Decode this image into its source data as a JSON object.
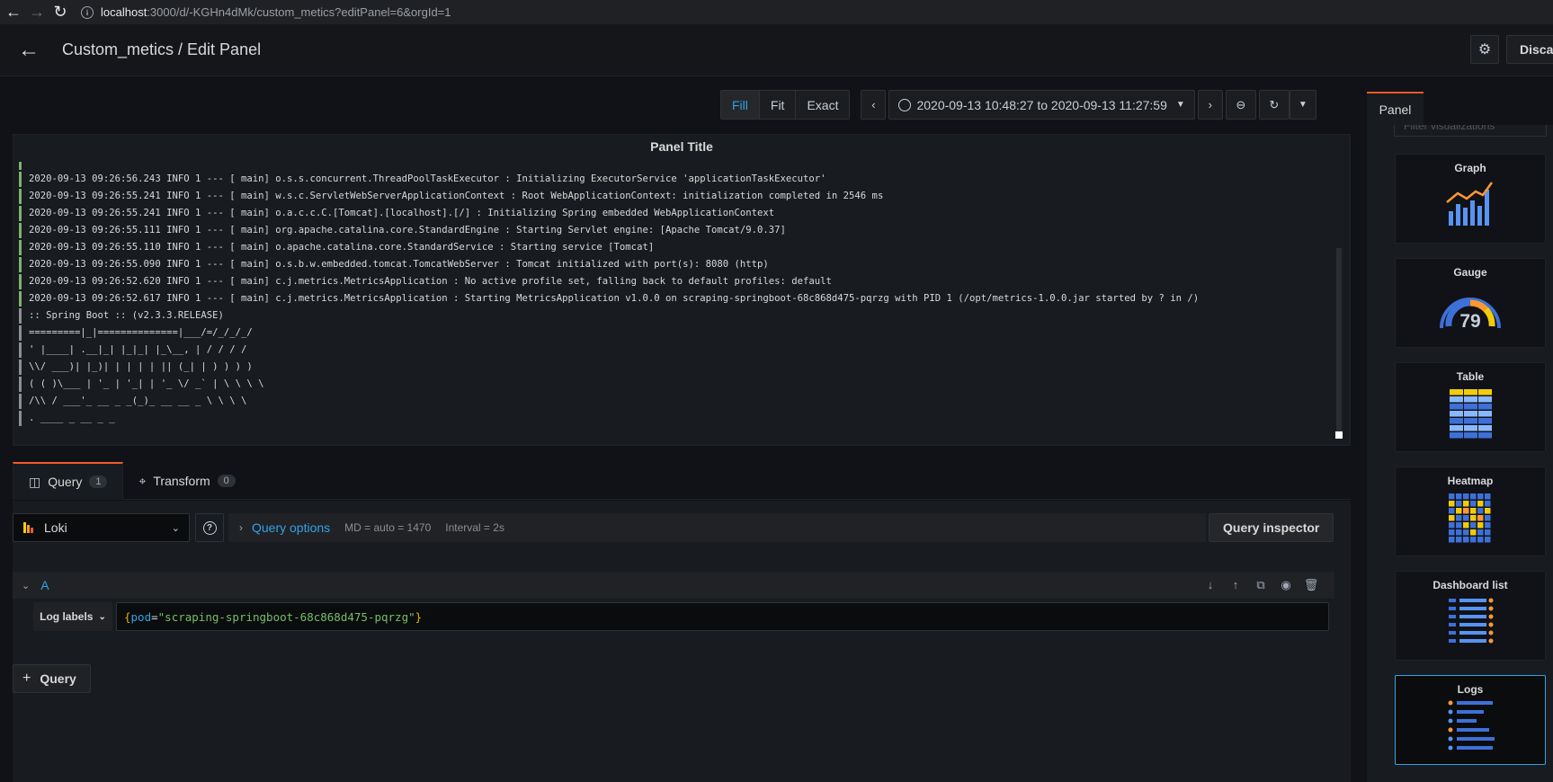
{
  "browser": {
    "url_host": "localhost",
    "url_path": ":3000/d/-KGHn4dMk/custom_metics?editPanel=6&orgId=1"
  },
  "header": {
    "title": "Custom_metics / Edit Panel",
    "discard_label": "Discard"
  },
  "toolbar": {
    "fit_modes": [
      "Fill",
      "Fit",
      "Exact"
    ],
    "active_mode": "Fill",
    "time_range": "2020-09-13 10:48:27 to 2020-09-13 11:27:59"
  },
  "panel": {
    "title": "Panel Title",
    "log_lines": [
      {
        "text": "2020-09-13 09:26:56.243 INFO 1 --- [ main] o.s.s.concurrent.ThreadPoolTaskExecutor : Initializing ExecutorService 'applicationTaskExecutor'",
        "level": "info"
      },
      {
        "text": "2020-09-13 09:26:55.241 INFO 1 --- [ main] w.s.c.ServletWebServerApplicationContext : Root WebApplicationContext: initialization completed in 2546 ms",
        "level": "info"
      },
      {
        "text": "2020-09-13 09:26:55.241 INFO 1 --- [ main] o.a.c.c.C.[Tomcat].[localhost].[/] : Initializing Spring embedded WebApplicationContext",
        "level": "info"
      },
      {
        "text": "2020-09-13 09:26:55.111 INFO 1 --- [ main] org.apache.catalina.core.StandardEngine : Starting Servlet engine: [Apache Tomcat/9.0.37]",
        "level": "info"
      },
      {
        "text": "2020-09-13 09:26:55.110 INFO 1 --- [ main] o.apache.catalina.core.StandardService : Starting service [Tomcat]",
        "level": "info"
      },
      {
        "text": "2020-09-13 09:26:55.090 INFO 1 --- [ main] o.s.b.w.embedded.tomcat.TomcatWebServer : Tomcat initialized with port(s): 8080 (http)",
        "level": "info"
      },
      {
        "text": "2020-09-13 09:26:52.620 INFO 1 --- [ main] c.j.metrics.MetricsApplication : No active profile set, falling back to default profiles: default",
        "level": "info"
      },
      {
        "text": "2020-09-13 09:26:52.617 INFO 1 --- [ main] c.j.metrics.MetricsApplication : Starting MetricsApplication v1.0.0 on scraping-springboot-68c868d475-pqrzg with PID 1 (/opt/metrics-1.0.0.jar started by ? in /)",
        "level": "info"
      },
      {
        "text": ":: Spring Boot :: (v2.3.3.RELEASE)",
        "level": "unknown"
      },
      {
        "text": "=========|_|==============|___/=/_/_/_/",
        "level": "unknown"
      },
      {
        "text": "' |____| .__|_| |_|_| |_\\__, | / / / /",
        "level": "unknown"
      },
      {
        "text": "\\\\/ ___)| |_)| | | | | || (_| | ) ) ) )",
        "level": "unknown"
      },
      {
        "text": "( ( )\\___ | '_ | '_| | '_ \\/ _` | \\ \\ \\ \\",
        "level": "unknown"
      },
      {
        "text": "/\\\\ / ___'_ __ _ _(_)_ __ __ _ \\ \\ \\ \\",
        "level": "unknown"
      },
      {
        "text": ". ____ _ __ _ _",
        "level": "unknown"
      }
    ],
    "colors": {
      "info": "#7eb26d",
      "unknown": "#8e8e8e"
    }
  },
  "query_tabs": [
    {
      "label": "Query",
      "count": "1",
      "icon": "database-icon"
    },
    {
      "label": "Transform",
      "count": "0",
      "icon": "transform-icon"
    }
  ],
  "datasource": {
    "name": "Loki",
    "query_options_label": "Query options",
    "md": "MD = auto = 1470",
    "interval": "Interval = 2s",
    "inspector_label": "Query inspector"
  },
  "query": {
    "ref_id": "A",
    "labels_button": "Log labels",
    "expr_key": "pod",
    "expr_value": "\"scraping-springboot-68c868d475-pqrzg\""
  },
  "add_query_label": "Query",
  "options_pane": {
    "tab_label": "Panel",
    "filter_placeholder": "Filter visualizations",
    "visualizations": [
      {
        "name": "Graph",
        "icon": "graph-icon"
      },
      {
        "name": "Gauge",
        "icon": "gauge-icon",
        "value": "79"
      },
      {
        "name": "Table",
        "icon": "table-icon"
      },
      {
        "name": "Heatmap",
        "icon": "heatmap-icon"
      },
      {
        "name": "Dashboard list",
        "icon": "dashboard-list-icon"
      },
      {
        "name": "Logs",
        "icon": "logs-icon",
        "selected": true
      }
    ]
  }
}
